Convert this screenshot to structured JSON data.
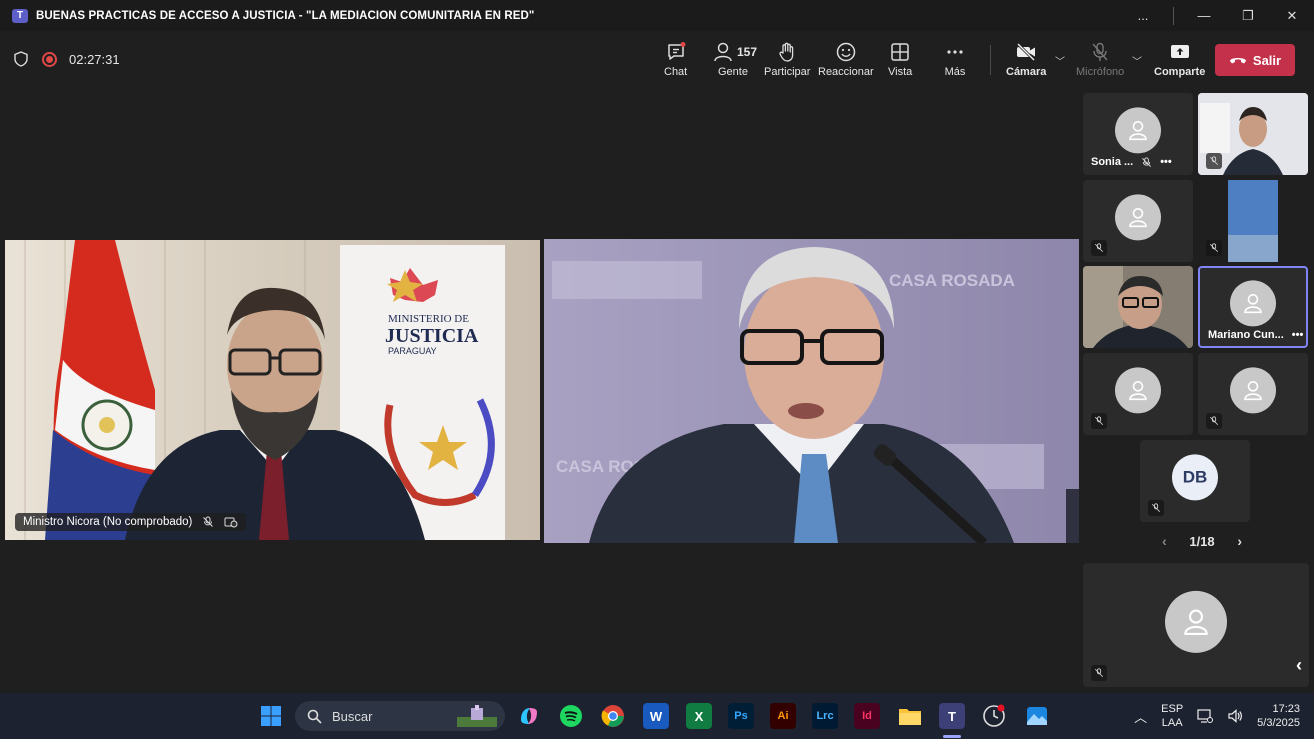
{
  "window": {
    "title": "BUENAS PRACTICAS DE ACCESO A JUSTICIA - \"LA MEDIACION COMUNITARIA EN RED\"",
    "controls": [
      "...",
      "—",
      "❐",
      "✕"
    ]
  },
  "meeting": {
    "timer": "02:27:31",
    "toolbar": {
      "chat": "Chat",
      "people": "Gente",
      "people_count": "157",
      "raise": "Participar",
      "react": "Reaccionar",
      "view": "Vista",
      "more": "Más",
      "camera": "Cámara",
      "mic": "Micrófono",
      "share": "Comparte",
      "leave": "Salir"
    }
  },
  "stage": {
    "left_tile": {
      "name": "Ministro Nicora (No comprobado)",
      "banner_line1": "MINISTERIO DE",
      "banner_line2": "JUSTICIA",
      "banner_line3": "PARAGUAY"
    },
    "right_tile": {
      "backdrop_text_1": "CASA ROSADA",
      "backdrop_text_2": "CASA ROSADA"
    }
  },
  "participants": {
    "sonia": "Sonia ...",
    "mariano": "Mariano Cun...",
    "db_initials": "DB",
    "page": "1/18"
  },
  "taskbar": {
    "search_placeholder": "Buscar",
    "lang_top": "ESP",
    "lang_bottom": "LAA",
    "time": "17:23",
    "date": "5/3/2025",
    "apps": [
      "Ps",
      "Ai",
      "Lrc",
      "Id"
    ]
  },
  "colors": {
    "leave_red": "#c4314b",
    "active_border": "#7f85f5",
    "teams_purple": "#5b5fc7"
  }
}
